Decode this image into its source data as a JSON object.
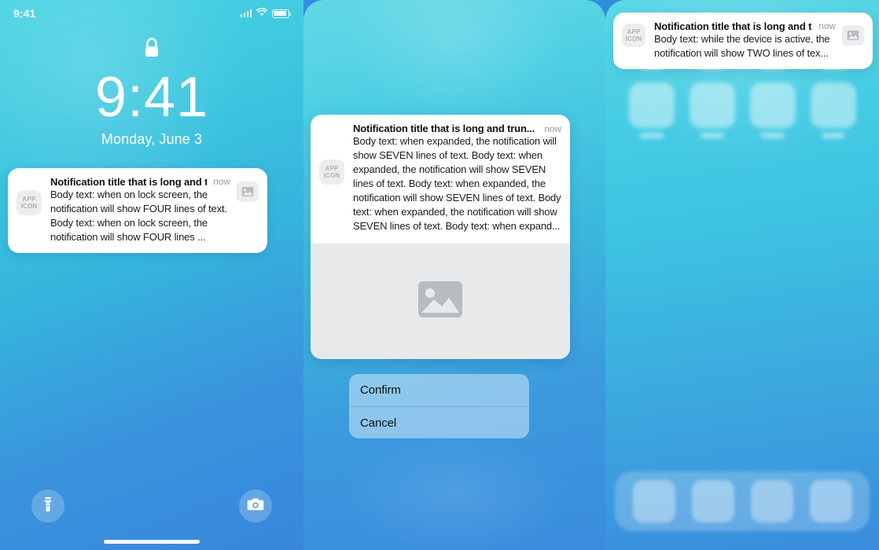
{
  "lock_screen": {
    "status_bar": {
      "time": "9:41",
      "signal_icon": "cellular-signal-icon",
      "wifi_icon": "wifi-icon",
      "battery_icon": "battery-icon"
    },
    "lock_icon": "lock-closed-icon",
    "clock": "9:41",
    "date": "Monday, June 3",
    "notification": {
      "app_icon_label": "APP\nICON",
      "app_icon_line1": "APP",
      "app_icon_line2": "ICON",
      "title": "Notification title that is long and trun...",
      "time": "now",
      "body": "Body text: when on lock screen, the notification will show FOUR lines of text. Body text: when on lock screen, the notification will show FOUR lines ...",
      "thumbnail_icon": "image-placeholder-icon"
    },
    "flashlight_button": "flashlight-icon",
    "camera_button": "camera-icon",
    "home_indicator": "home-indicator"
  },
  "expanded_notification": {
    "notification": {
      "app_icon_line1": "APP",
      "app_icon_line2": "ICON",
      "title": "Notification title that is long and trun...",
      "time": "now",
      "body": "Body text: when expanded, the notification will show SEVEN lines of text. Body text: when expanded, the notification will show SEVEN lines of text. Body text: when expanded, the notification will show SEVEN lines of text. Body text: when expanded, the notification will show SEVEN lines of text. Body text: when expand...",
      "attachment_icon": "image-placeholder-icon"
    },
    "actions": [
      {
        "label": "Confirm"
      },
      {
        "label": "Cancel"
      }
    ]
  },
  "home_screen": {
    "notification": {
      "app_icon_line1": "APP",
      "app_icon_line2": "ICON",
      "title": "Notification title that is long and trun...",
      "time": "now",
      "body": "Body text: while the device is active, the notification will show TWO lines of tex...",
      "thumbnail_icon": "image-placeholder-icon"
    },
    "app_rows": 2,
    "apps_per_row": 4,
    "dock_items": 4
  },
  "colors": {
    "background_top": "#4ad4e4",
    "background_bottom": "#3a8cdd",
    "card_background": "#ffffff",
    "placeholder_gray": "#ededed",
    "attachment_gray": "#e8e9ea",
    "title_text": "#111111",
    "time_text": "#999999"
  }
}
